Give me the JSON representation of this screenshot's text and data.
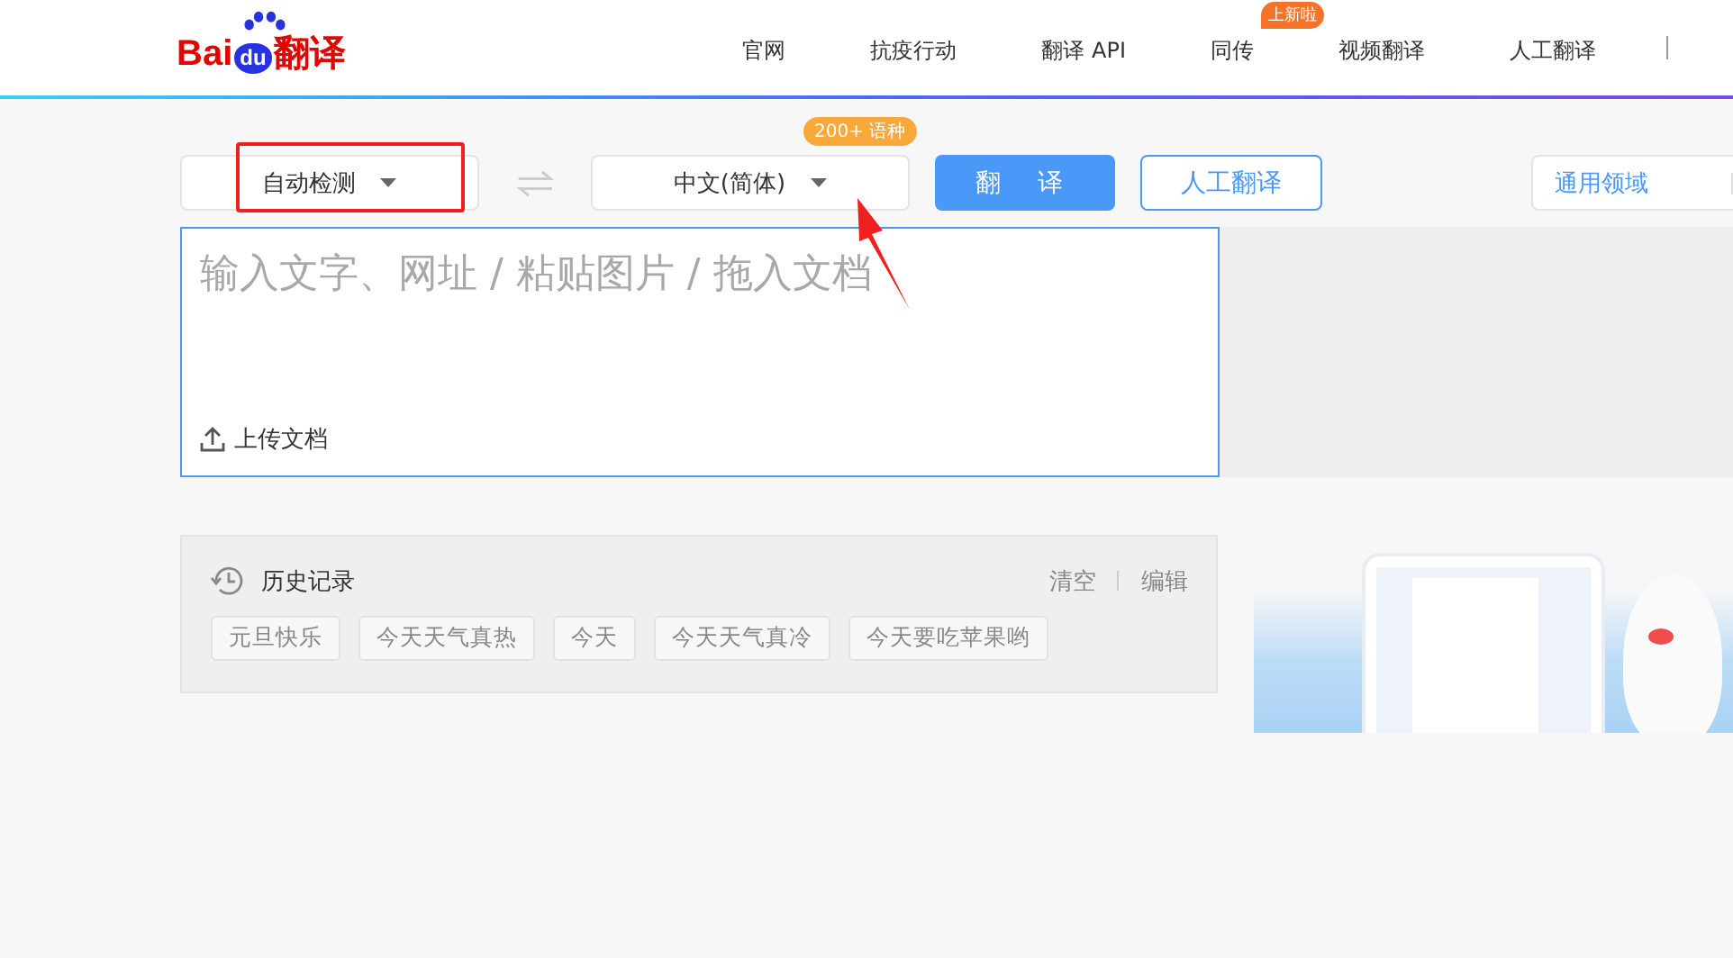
{
  "header": {
    "logo": {
      "left": "Bai",
      "paw": "du",
      "right": "翻译"
    },
    "nav": [
      {
        "label": "官网"
      },
      {
        "label": "抗疫行动"
      },
      {
        "label": "翻译 API"
      },
      {
        "label": "同传",
        "badge": "上新啦"
      },
      {
        "label": "视频翻译"
      },
      {
        "label": "人工翻译"
      }
    ]
  },
  "toolbar": {
    "source_language": "自动检测",
    "target_language": "中文(简体)",
    "language_badge": "200+ 语种",
    "translate_button": "翻 译",
    "human_button": "人工翻译",
    "domain": "通用领域"
  },
  "input": {
    "placeholder": "输入文字、网址 / 粘贴图片 / 拖入文档",
    "upload": "上传文档"
  },
  "history": {
    "title": "历史记录",
    "clear": "清空",
    "edit": "编辑",
    "items": [
      "元旦快乐",
      "今天天气真热",
      "今天",
      "今天天气真冷",
      "今天要吃苹果哟"
    ]
  }
}
